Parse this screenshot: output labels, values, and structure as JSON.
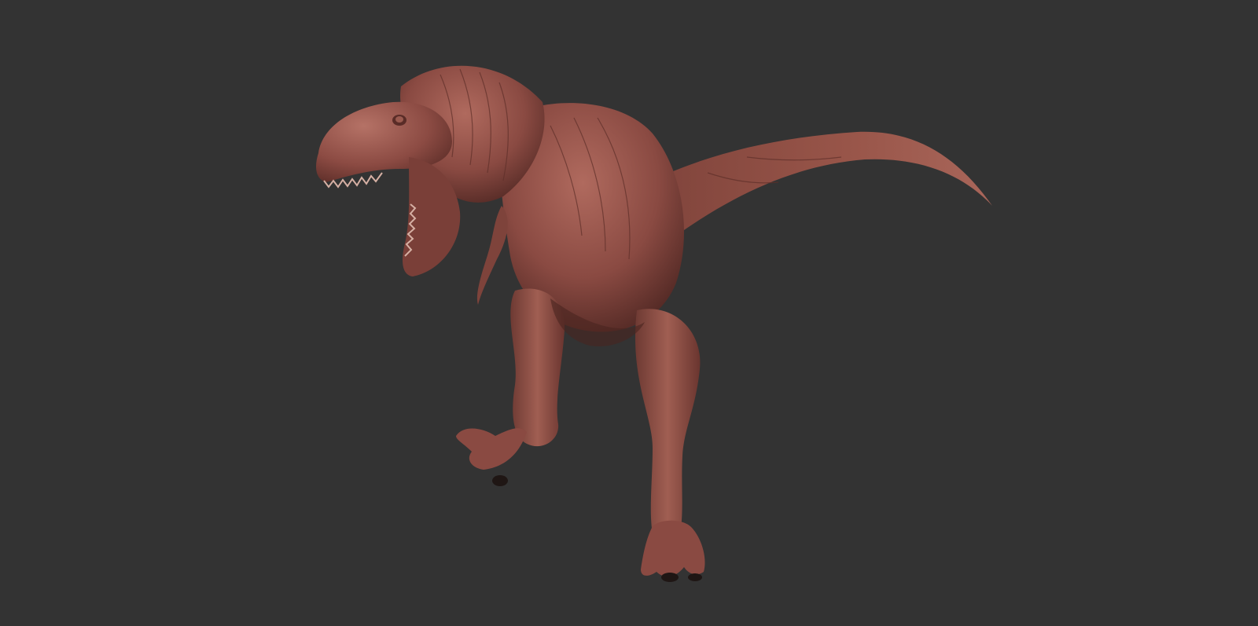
{
  "scene": {
    "background_color": "#333333",
    "subject": "tyrannosaurus-sculpt",
    "material_color": "#8a4a42",
    "highlight_color": "#b06a5e",
    "shadow_color": "#4a2420"
  }
}
